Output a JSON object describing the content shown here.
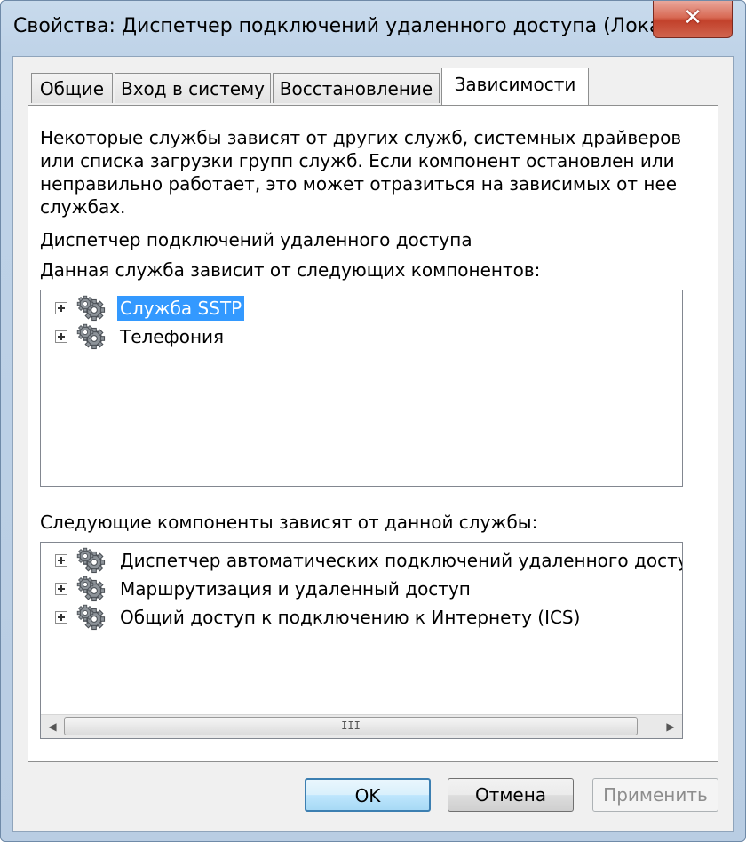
{
  "window": {
    "title": "Свойства: Диспетчер подключений удаленного доступа (Лока...",
    "close_label": "✕"
  },
  "tabs": [
    {
      "label": "Общие",
      "active": false
    },
    {
      "label": "Вход в систему",
      "active": false
    },
    {
      "label": "Восстановление",
      "active": false
    },
    {
      "label": "Зависимости",
      "active": true
    }
  ],
  "dependencies": {
    "description_lines": [
      "Некоторые службы зависят от других служб, системных драйверов",
      "или списка загрузки групп служб. Если компонент остановлен или",
      "неправильно работает, это может отразиться на зависимых от нее",
      "службах."
    ],
    "service_name": "Диспетчер подключений удаленного доступа",
    "depends_on_label": "Данная служба зависит от следующих компонентов:",
    "depends_on": [
      {
        "label": "Служба SSTP",
        "icon": "gears-icon",
        "selected": true
      },
      {
        "label": "Телефония",
        "icon": "gears-icon",
        "selected": false
      }
    ],
    "dependents_label": "Следующие компоненты зависят от данной службы:",
    "dependents": [
      {
        "label": "Диспетчер автоматических подключений удаленного доступа",
        "icon": "gears-icon"
      },
      {
        "label": "Маршрутизация и удаленный доступ",
        "icon": "gears-icon"
      },
      {
        "label": "Общий доступ к подключению к Интернету (ICS)",
        "icon": "gears-icon"
      }
    ],
    "scroll_thumb_grip": "III"
  },
  "buttons": {
    "ok": "OK",
    "cancel": "Отмена",
    "apply": "Применить"
  },
  "colors": {
    "selection": "#3399ff",
    "close_button": "#c2412b",
    "default_button_border": "#3c7fb1"
  }
}
